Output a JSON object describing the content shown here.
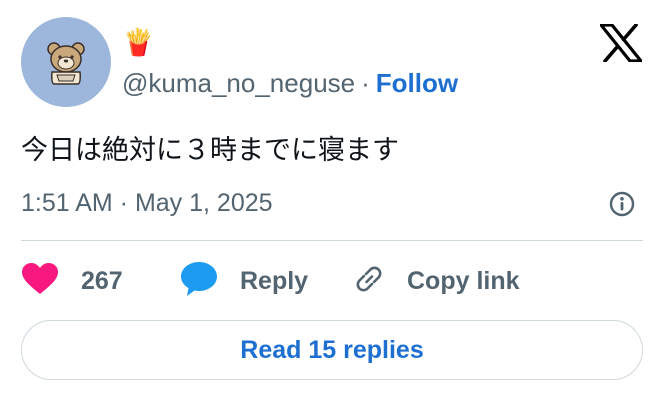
{
  "author": {
    "display_name_emoji": "🍟",
    "handle": "@kuma_no_neguse",
    "separator": "·",
    "follow_label": "Follow"
  },
  "tweet": {
    "text": "今日は絶対に３時までに寝ます",
    "timestamp": "1:51 AM · May 1, 2025"
  },
  "actions": {
    "like_count": "267",
    "reply_label": "Reply",
    "copy_link_label": "Copy link"
  },
  "footer": {
    "read_replies_label": "Read 15 replies"
  },
  "colors": {
    "accent": "#1d6fd1",
    "like": "#f91880",
    "reply_bubble": "#1d9bf0",
    "avatar_bg": "#9db7dc",
    "secondary_text": "#536471"
  },
  "icons": {
    "brand": "x-logo-icon",
    "info": "info-icon",
    "like": "heart-icon",
    "reply": "speech-bubble-icon",
    "copy": "link-icon"
  }
}
